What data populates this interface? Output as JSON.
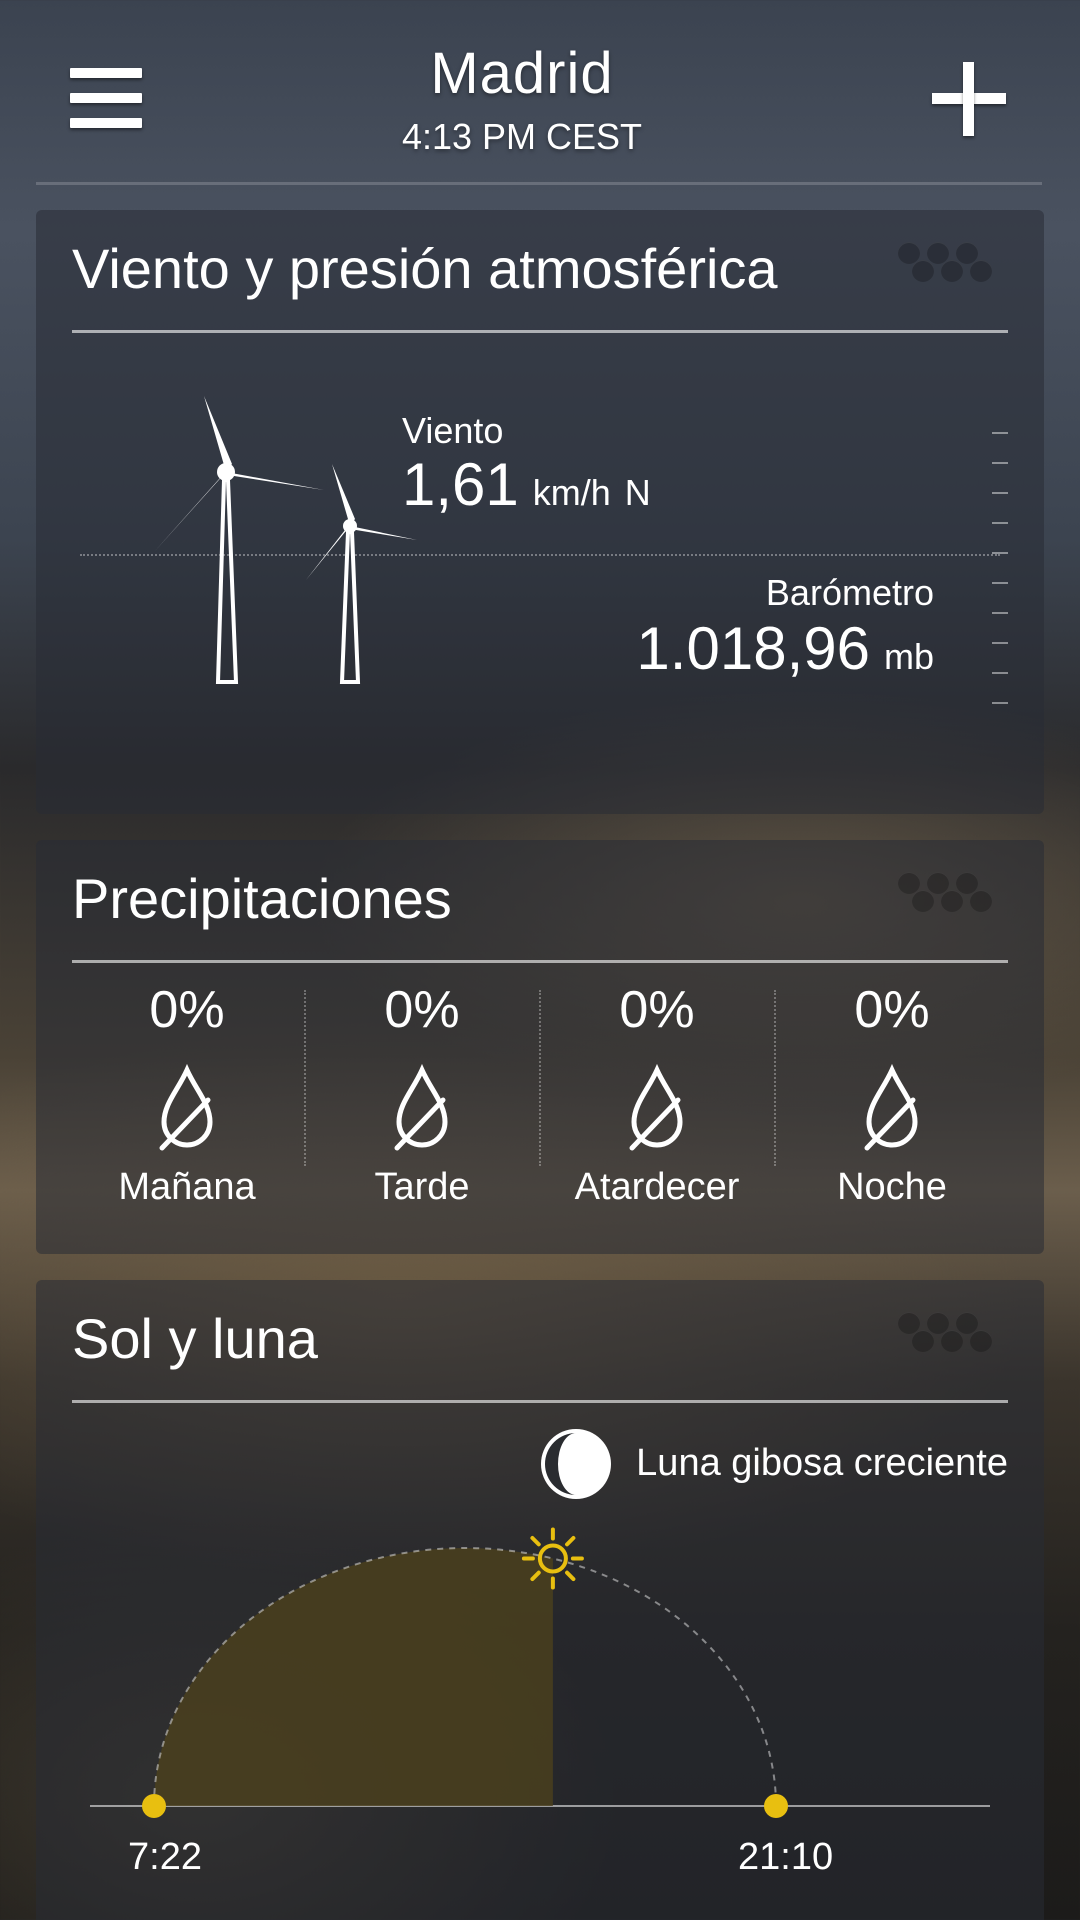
{
  "header": {
    "city": "Madrid",
    "time": "4:13 PM CEST"
  },
  "wind_card": {
    "title": "Viento y presión atmosférica",
    "wind": {
      "label": "Viento",
      "value": "1,61",
      "unit": "km/h",
      "direction": "N"
    },
    "barometer": {
      "label": "Barómetro",
      "value": "1.018,96",
      "unit": "mb"
    }
  },
  "precip_card": {
    "title": "Precipitaciones",
    "periods": [
      {
        "label": "Mañana",
        "percent": "0%"
      },
      {
        "label": "Tarde",
        "percent": "0%"
      },
      {
        "label": "Atardecer",
        "percent": "0%"
      },
      {
        "label": "Noche",
        "percent": "0%"
      }
    ]
  },
  "sun_card": {
    "title": "Sol y luna",
    "moon_phase": "Luna gibosa creciente",
    "sunrise": "7:22",
    "sunset": "21:10",
    "current_time": "16:13"
  },
  "icons": {
    "menu": "menu-icon",
    "add": "add-icon",
    "turbine": "wind-turbine-icon",
    "drop": "drop-slash-icon",
    "moon": "moon-icon",
    "sun": "sun-icon"
  },
  "colors": {
    "sun_accent": "#e8bf10",
    "daylight_fill": "#4a401d"
  }
}
